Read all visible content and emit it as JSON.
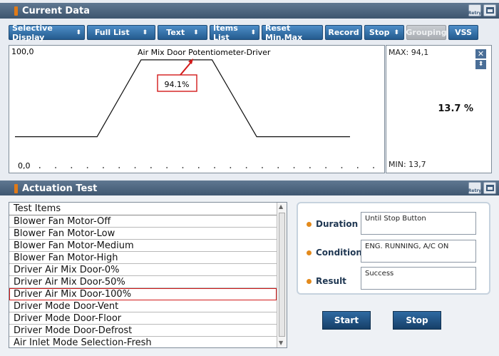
{
  "top_window": {
    "title": "Current Data"
  },
  "toolbar": {
    "selective_display": "Selective Display",
    "full_list": "Full List",
    "text": "Text",
    "items_list": "Items List",
    "reset_min_max": "Reset Min.Max",
    "record": "Record",
    "stop": "Stop",
    "grouping": "Grouping",
    "vss": "VSS"
  },
  "graph": {
    "title": "Air Mix Door Potentiometer-Driver",
    "y_max_label": "100,0",
    "y_min_label": "0,0",
    "annotation": "94.1%",
    "max_label": "MAX: 94,1",
    "min_label": "MIN: 13,7",
    "current_value": "13.7 %"
  },
  "chart_data": {
    "type": "line",
    "title": "Air Mix Door Potentiometer-Driver",
    "ylim": [
      0,
      100
    ],
    "x": [
      0,
      1,
      2,
      3,
      4,
      5,
      6,
      7,
      8
    ],
    "values": [
      13.7,
      13.7,
      94.1,
      94.1,
      94.1,
      13.7,
      13.7,
      13.7,
      13.7
    ]
  },
  "bottom_window": {
    "title": "Actuation Test"
  },
  "test_list": {
    "header": "Test Items",
    "items": [
      "Blower Fan Motor-Off",
      "Blower Fan Motor-Low",
      "Blower Fan Motor-Medium",
      "Blower Fan Motor-High",
      "Driver Air Mix Door-0%",
      "Driver Air Mix Door-50%",
      "Driver Air Mix Door-100%",
      "Driver Mode Door-Vent",
      "Driver Mode Door-Floor",
      "Driver Mode Door-Defrost",
      "Air Inlet Mode Selection-Fresh"
    ],
    "selected_index": 6
  },
  "info": {
    "duration_label": "Duration",
    "duration_value": "Until Stop Button",
    "conditions_label": "Conditions",
    "conditions_value": "ENG. RUNNING, A/C ON",
    "result_label": "Result",
    "result_value": "Success"
  },
  "buttons": {
    "start": "Start",
    "stop": "Stop"
  },
  "icons": {
    "retry": "Retry"
  },
  "colors": {
    "accent": "#245b8e",
    "selection": "#d21a1a",
    "title_bar": "#4a627c"
  }
}
